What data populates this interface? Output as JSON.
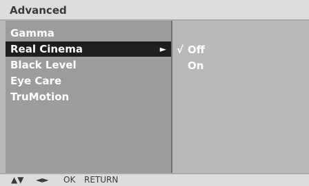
{
  "header": {
    "title": "Advanced"
  },
  "menu": {
    "items": [
      {
        "label": "Gamma"
      },
      {
        "label": "Real Cinema",
        "arrow": "►"
      },
      {
        "label": "Black Level"
      },
      {
        "label": "Eye Care"
      },
      {
        "label": "TruMotion"
      }
    ],
    "selected_index": 1
  },
  "options": {
    "items": [
      {
        "label": "Off",
        "checked": true,
        "check_mark": "√"
      },
      {
        "label": "On",
        "checked": false,
        "check_mark": ""
      }
    ]
  },
  "footer": {
    "updown": "▲▼",
    "leftright": "◄►",
    "ok": "OK",
    "return": "RETURN"
  },
  "colors": {
    "header_bg": "#dcdcdc",
    "menu_bg": "#9c9c9c",
    "selected_bg": "#1e1e1e",
    "panel_bg": "#b9b9b9",
    "text": "#ffffff"
  }
}
